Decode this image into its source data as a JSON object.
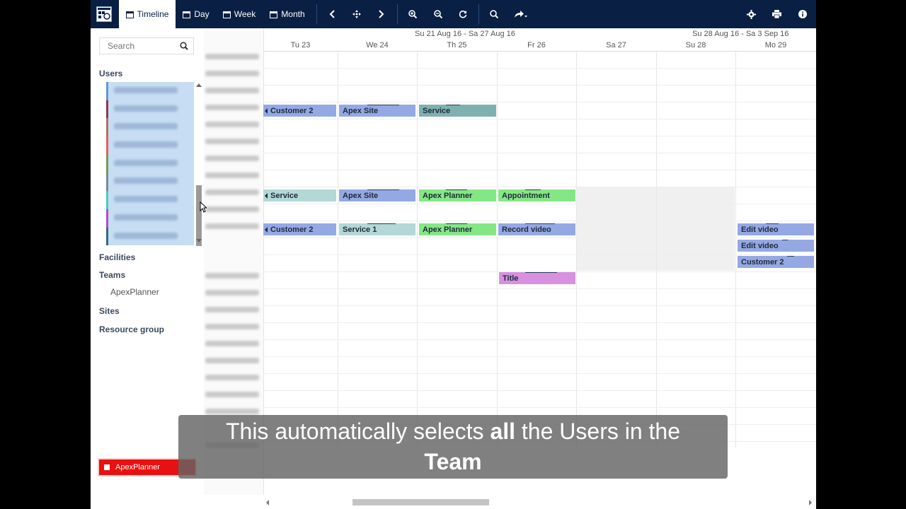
{
  "toolbar": {
    "timeline": "Timeline",
    "day": "Day",
    "week": "Week",
    "month": "Month"
  },
  "sidebar": {
    "search_placeholder": "Search",
    "users_title": "Users",
    "facilities": "Facilities",
    "teams": "Teams",
    "team_item": "ApexPlanner",
    "sites": "Sites",
    "resource_group": "Resource group",
    "user_colors": [
      "#5b9bd5",
      "#8b3a4a",
      "#b07060",
      "#e06060",
      "#7a9a50",
      "#7a8a9a",
      "#50c8c0",
      "#b050c0",
      "#3a6a7a"
    ]
  },
  "footer": {
    "label": "ApexPlanner"
  },
  "scheduler": {
    "week1": "Su 21 Aug 16 - Sa 27 Aug 16",
    "week2": "Su 28 Aug 16 - Sa 3 Sep 16",
    "days": [
      "Tu 23",
      "We 24",
      "Th 25",
      "Fr 26",
      "Sa 27",
      "Su 28",
      "Mo 29"
    ]
  },
  "events": {
    "e1": "Customer 2",
    "e2": "Apex Site",
    "e3": "Service",
    "e4": "Service",
    "e5": "Apex Site",
    "e6": "Apex Planner",
    "e7": "Appointment",
    "e8": "Customer 2",
    "e9": "Service 1",
    "e10": "Apex Planner",
    "e11": "Record video",
    "e12": "Edit video",
    "e13": "Edit video",
    "e14": "Customer 2",
    "e15": "Title"
  },
  "event_colors": {
    "blue": "#94a8e4",
    "teal": "#7fb0b0",
    "lightteal": "#b3d8d6",
    "green": "#85e685",
    "pink": "#d890e0"
  },
  "caption": {
    "pre": "This automatically selects ",
    "bold1": "all",
    "mid": " the Users in the",
    "bold2": "Team"
  }
}
